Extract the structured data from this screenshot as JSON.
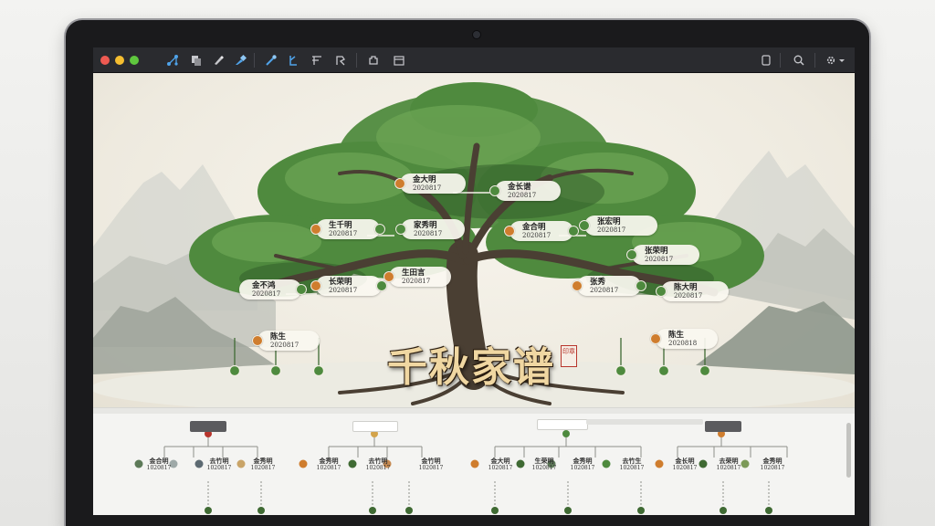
{
  "app": {
    "toolbar": {
      "icons": [
        "connect-tool-icon",
        "copy-icon",
        "brush-icon",
        "color-picker-icon",
        "link-tool-icon",
        "branch-tool-icon",
        "text-tool-icon",
        "shape-tool-icon",
        "plugin-icon",
        "folder-icon",
        "page-view-icon",
        "search-icon",
        "settings-gear-icon"
      ]
    }
  },
  "canvas": {
    "title": "千秋家谱",
    "seal": "印章",
    "nodes": [
      {
        "name": "金大明",
        "date": "2020817"
      },
      {
        "name": "金长谱",
        "date": "2020817"
      },
      {
        "name": "生千明",
        "date": "2020817"
      },
      {
        "name": "家秀明",
        "date": "2020817"
      },
      {
        "name": "金合明",
        "date": "2020817"
      },
      {
        "name": "张宏明",
        "date": "2020817"
      },
      {
        "name": "金不鸿",
        "date": "2020817"
      },
      {
        "name": "长荣明",
        "date": "2020817"
      },
      {
        "name": "生田言",
        "date": "2020817"
      },
      {
        "name": "张荣明",
        "date": "2020817"
      },
      {
        "name": "张秀",
        "date": "2020817"
      },
      {
        "name": "陈大明",
        "date": "2020817"
      },
      {
        "name": "陈生",
        "date": "2020817"
      },
      {
        "name": "陈生",
        "date": "2020818"
      }
    ]
  },
  "panel": {
    "groups": [
      {
        "nodes": [
          {
            "name": "金合明",
            "date": "1020817"
          },
          {
            "name": "去竹明",
            "date": "1020817"
          },
          {
            "name": "金秀明",
            "date": "1020817"
          }
        ]
      },
      {
        "nodes": [
          {
            "name": "金秀明",
            "date": "1020817"
          },
          {
            "name": "去竹明",
            "date": "1020817"
          },
          {
            "name": "金竹明",
            "date": "1020817"
          }
        ]
      },
      {
        "nodes": [
          {
            "name": "金大明",
            "date": "1020817"
          },
          {
            "name": "生荣明",
            "date": "1020817"
          },
          {
            "name": "金秀明",
            "date": "1020817"
          },
          {
            "name": "去竹生",
            "date": "1020817"
          }
        ]
      },
      {
        "nodes": [
          {
            "name": "金长明",
            "date": "1020817"
          },
          {
            "name": "去荣明",
            "date": "1020817"
          },
          {
            "name": "金秀明",
            "date": "1020817"
          }
        ]
      }
    ]
  },
  "colors": {
    "accent_orange": "#cf7d2e",
    "accent_green": "#4e8a3e",
    "toolbar_bg": "#2a2b2f",
    "title_gold": "#f0d7a2",
    "seal_red": "#b8352c"
  }
}
